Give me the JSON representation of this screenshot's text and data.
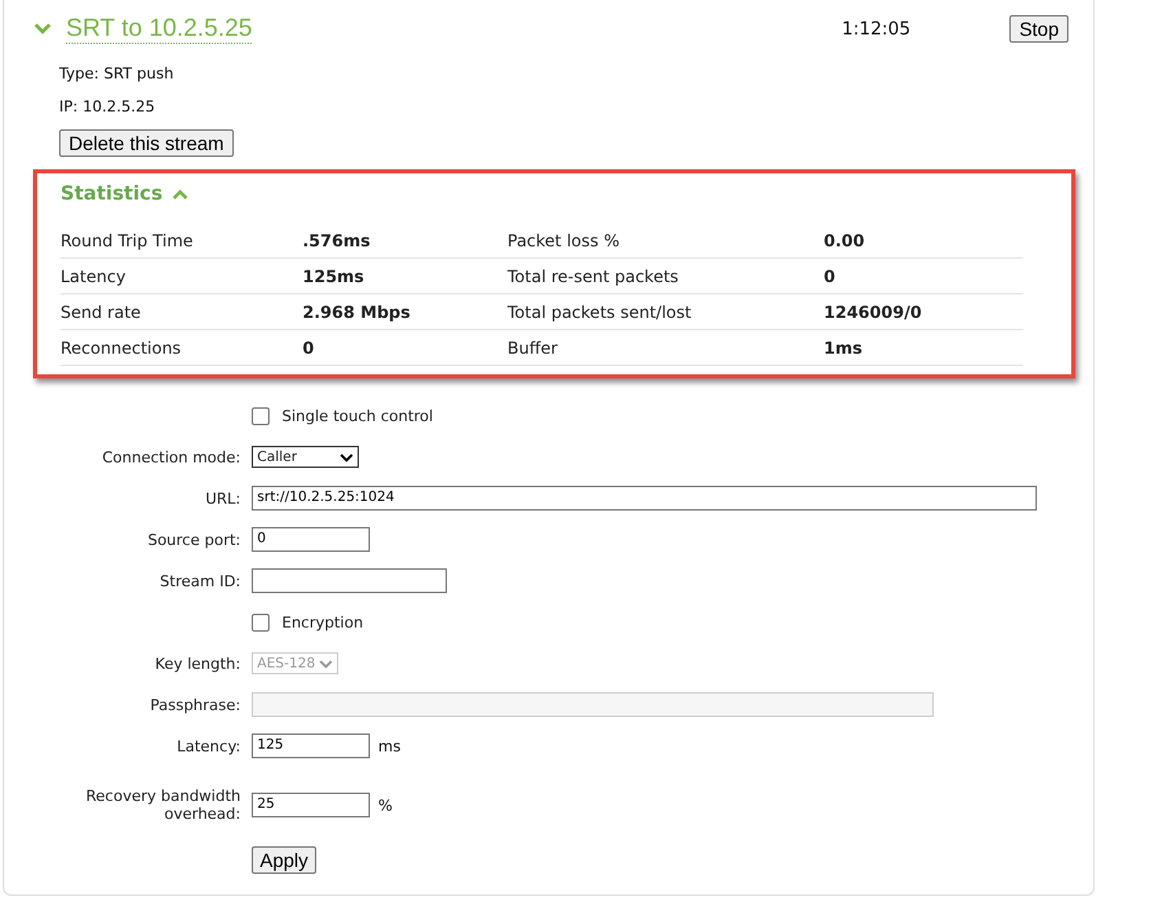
{
  "stream": {
    "title": "SRT to 10.2.5.25",
    "expanded": true,
    "elapsed": "1:12:05",
    "stop_button": "Stop",
    "type": "Type: SRT push",
    "ip": "IP: 10.2.5.25",
    "delete_button": "Delete this stream"
  },
  "statistics": {
    "title": "Statistics",
    "expanded": true,
    "rows": [
      {
        "label_1": "Round Trip Time",
        "value_1": ".576ms",
        "label_2": "Packet loss %",
        "value_2": "0.00"
      },
      {
        "label_1": "Latency",
        "value_1": "125ms",
        "label_2": "Total re-sent packets",
        "value_2": "0"
      },
      {
        "label_1": "Send rate",
        "value_1": "2.968 Mbps",
        "label_2": "Total packets sent/lost",
        "value_2": "1246009/0"
      },
      {
        "label_1": "Reconnections",
        "value_1": "0",
        "label_2": "Buffer",
        "value_2": "1ms"
      }
    ]
  },
  "form": [
    {
      "kind": "checkbox",
      "text": "Single touch control",
      "checked": false
    },
    {
      "kind": "select",
      "label": "Connection mode:",
      "value": "Caller",
      "disabled": false
    },
    {
      "kind": "text",
      "label": "URL:",
      "value": "srt://10.2.5.25:1024",
      "disabled": false
    },
    {
      "kind": "text",
      "label": "Source port:",
      "value": "0",
      "disabled": false
    },
    {
      "kind": "text",
      "label": "Stream ID:",
      "disabled": false
    },
    {
      "kind": "checkbox",
      "text": "Encryption",
      "checked": false
    },
    {
      "kind": "select",
      "label": "Key length:",
      "value": "AES-128",
      "disabled": true
    },
    {
      "kind": "text",
      "label": "Passphrase:",
      "disabled": true
    },
    {
      "kind": "text",
      "label": "Latency:",
      "value": "125",
      "unit": "ms",
      "disabled": false
    },
    {
      "kind": "text",
      "label": "Recovery bandwidth overhead:",
      "value": "25",
      "unit": "%",
      "disabled": false
    },
    {
      "kind": "button",
      "text": "Apply"
    }
  ]
}
